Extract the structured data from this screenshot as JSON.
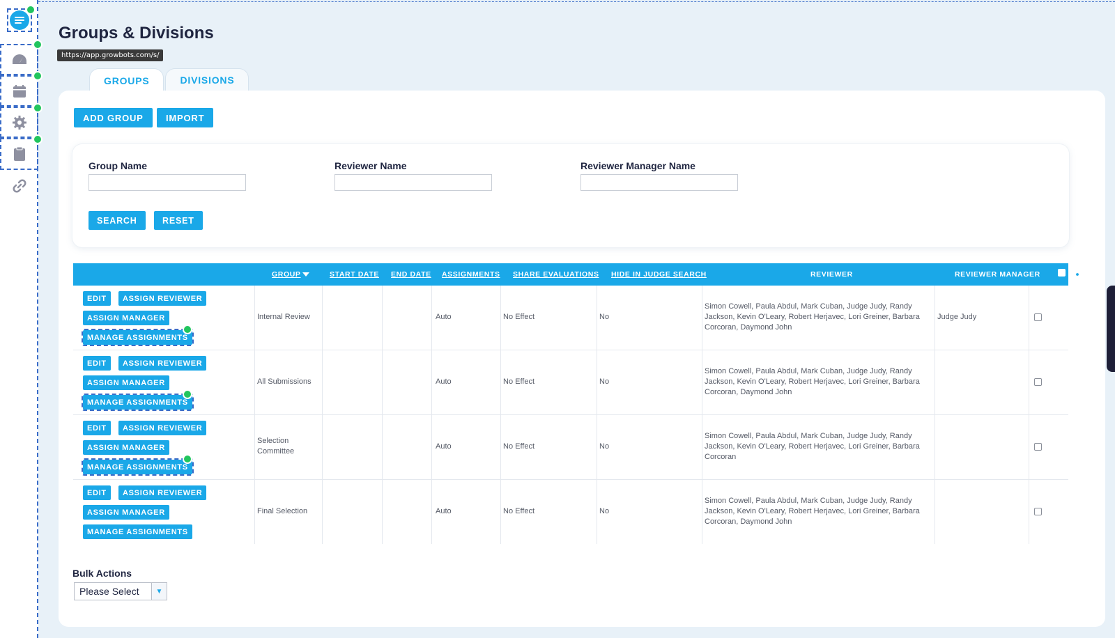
{
  "tooltip": "https://app.growbots.com/s/",
  "page": {
    "title": "Groups & Divisions"
  },
  "tabs": [
    {
      "label": "GROUPS",
      "active": true
    },
    {
      "label": "DIVISIONS",
      "active": false
    }
  ],
  "toolbar": {
    "add_group": "ADD GROUP",
    "import": "IMPORT"
  },
  "filters": {
    "group_name_label": "Group Name",
    "reviewer_name_label": "Reviewer Name",
    "reviewer_manager_name_label": "Reviewer Manager Name",
    "group_name_value": "",
    "reviewer_name_value": "",
    "reviewer_manager_name_value": "",
    "search": "SEARCH",
    "reset": "RESET"
  },
  "table": {
    "columns": {
      "group": "GROUP",
      "start_date": "START DATE",
      "end_date": "END DATE",
      "assignments": "ASSIGNMENTS",
      "share_evaluations": "SHARE EVALUATIONS",
      "hide_in_judge_search": "HIDE IN JUDGE SEARCH",
      "reviewer": "REVIEWER",
      "reviewer_manager": "REVIEWER MANAGER"
    },
    "row_actions": {
      "edit": "EDIT",
      "assign_reviewer": "ASSIGN REVIEWER",
      "assign_manager": "ASSIGN MANAGER",
      "manage_assignments": "MANAGE ASSIGNMENTS"
    },
    "rows": [
      {
        "group": "Internal Review",
        "start_date": "",
        "end_date": "",
        "assignments": "Auto",
        "share_evaluations": "No Effect",
        "hide_in_judge_search": "No",
        "reviewer": "Simon Cowell, Paula Abdul, Mark Cuban, Judge Judy, Randy Jackson, Kevin O'Leary, Robert Herjavec, Lori Greiner, Barbara Corcoran, Daymond John",
        "reviewer_manager": "Judge Judy"
      },
      {
        "group": "All Submissions",
        "start_date": "",
        "end_date": "",
        "assignments": "Auto",
        "share_evaluations": "No Effect",
        "hide_in_judge_search": "No",
        "reviewer": "Simon Cowell, Paula Abdul, Mark Cuban, Judge Judy, Randy Jackson, Kevin O'Leary, Robert Herjavec, Lori Greiner, Barbara Corcoran, Daymond John",
        "reviewer_manager": ""
      },
      {
        "group": "Selection Committee",
        "start_date": "",
        "end_date": "",
        "assignments": "Auto",
        "share_evaluations": "No Effect",
        "hide_in_judge_search": "No",
        "reviewer": "Simon Cowell, Paula Abdul, Mark Cuban, Judge Judy, Randy Jackson, Kevin O'Leary, Robert Herjavec, Lori Greiner, Barbara Corcoran",
        "reviewer_manager": ""
      },
      {
        "group": "Final Selection",
        "start_date": "",
        "end_date": "",
        "assignments": "Auto",
        "share_evaluations": "No Effect",
        "hide_in_judge_search": "No",
        "reviewer": "Simon Cowell, Paula Abdul, Mark Cuban, Judge Judy, Randy Jackson, Kevin O'Leary, Robert Herjavec, Lori Greiner, Barbara Corcoran, Daymond John",
        "reviewer_manager": ""
      }
    ]
  },
  "bulk": {
    "label": "Bulk Actions",
    "selected": "Please Select"
  },
  "sidebar": {
    "icons": [
      "logo-icon",
      "dashboard-icon",
      "calendar-icon",
      "gear-icon",
      "clipboard-icon",
      "link-icon"
    ]
  },
  "colors": {
    "accent": "#1aa8e8",
    "background": "#e8f1f8",
    "highlight": "#3a6cc8",
    "badge": "#22c55e"
  }
}
